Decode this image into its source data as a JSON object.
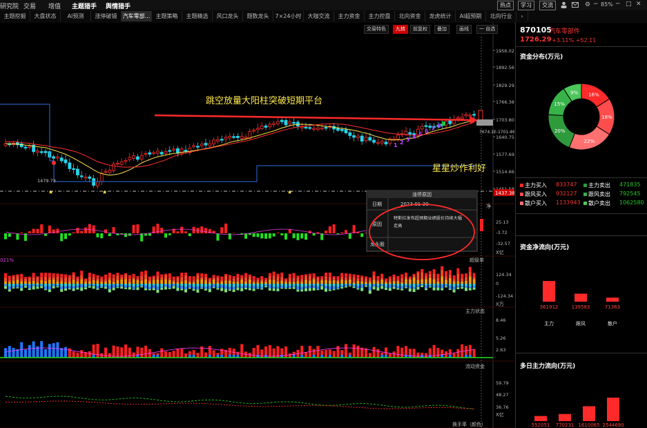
{
  "menu": {
    "items": [
      "研究院",
      "交易",
      "增值",
      "主题猎手",
      "舆情猎手"
    ],
    "right_buttons": [
      "热点",
      "学习",
      "交流"
    ],
    "zoom": "85%"
  },
  "tabs": [
    "主题挖掘",
    "大盘状态",
    "AI预测",
    "涨停破镜",
    "汽车零部...",
    "主题策略",
    "主题精选",
    "风口龙头",
    "题数龙头",
    "7×24小时",
    "大咖交流",
    "主力资金",
    "主力控盘",
    "北向资金",
    "龙虎统计",
    "AI超预期",
    "北向行业"
  ],
  "active_tab": "汽车零部...",
  "toolbar": [
    "交易特色",
    "九转",
    "前复权",
    "叠加",
    "画线",
    "一 自选"
  ],
  "chart": {
    "y_ticks": [
      "1956.02",
      "1892.56",
      "1829.29",
      "1766.38",
      "1703.80",
      "1640.75",
      "1577.69",
      "1514.66",
      "1451.58",
      "1437.38"
    ],
    "current_price_box": "1437.38",
    "low_label": "1479.73",
    "price_label": "7674.1E-1701.46",
    "annotation1": "跳空放量大阳柱突破短期平台",
    "annotation2": "星星炒作利好",
    "magic_digits": [
      "1",
      "2",
      "3",
      "4",
      "5",
      "6",
      "7",
      "8"
    ],
    "panel2": {
      "ticks": [
        "25.13",
        "-3.72",
        "-32.57"
      ],
      "unit": "X亿",
      "label": "净"
    },
    "panel3": {
      "ticks": [
        "124.34",
        "0",
        "-124.34"
      ],
      "unit": "X万",
      "label": "超级单",
      "left_tag": "021%"
    },
    "panel4": {
      "ticks": [
        "8.46",
        "5.26",
        "2.63"
      ],
      "label": "主力状态"
    },
    "panel5": {
      "ticks": [
        "59.79",
        "48.27",
        "36.76"
      ],
      "unit": "X亿",
      "label": "流动资金"
    },
    "bottom_label": "换手率（颜色）"
  },
  "popup": {
    "title": "涨停原因",
    "rows": [
      {
        "key": "日期",
        "value": "2023-01-30"
      },
      {
        "key": "原因",
        "value": "特斯拉发布超预期业绩股价持续大幅走高"
      },
      {
        "key": "龙头股",
        "value": ""
      }
    ]
  },
  "right_panel": {
    "code": "870105",
    "name": "汽车零部件",
    "price": "1726.29",
    "change": "+3.11% +52.11",
    "distribution_title": "资金分布(万元)",
    "donut": [
      {
        "label": "16%",
        "value": 16,
        "color": "#ff2a2a"
      },
      {
        "label": "18%",
        "value": 18,
        "color": "#ff4d4d"
      },
      {
        "label": "22%",
        "value": 22,
        "color": "#ff7070"
      },
      {
        "label": "20%",
        "value": 20,
        "color": "#2e9a3c"
      },
      {
        "label": "15%",
        "value": 15,
        "color": "#37b34a"
      },
      {
        "label": "9%",
        "value": 9,
        "color": "#4cc75a"
      }
    ],
    "flows": [
      {
        "label": "主力买入",
        "value": "833747",
        "color": "#ff2a2a",
        "side": "buy"
      },
      {
        "label": "主力卖出",
        "value": "471835",
        "color": "#2c9a3c",
        "side": "sell"
      },
      {
        "label": "跟风买入",
        "value": "932127",
        "color": "#ff4d4d",
        "side": "buy"
      },
      {
        "label": "跟风卖出",
        "value": "792545",
        "color": "#37b34a",
        "side": "sell"
      },
      {
        "label": "散户买入",
        "value": "1133943",
        "color": "#ff7070",
        "side": "buy"
      },
      {
        "label": "散户卖出",
        "value": "1062580",
        "color": "#4cc75a",
        "side": "sell"
      }
    ],
    "net_title": "资金净流向(万元)",
    "net_bars": [
      {
        "label": "主力",
        "value": 361912,
        "text": "361912"
      },
      {
        "label": "跟风",
        "value": 139583,
        "text": "139583"
      },
      {
        "label": "散户",
        "value": 71363,
        "text": "71363"
      }
    ],
    "multi_title": "多日主力流向(万元)",
    "multi_bars": [
      {
        "value": 552051,
        "text": "552051"
      },
      {
        "value": 770231,
        "text": "770231"
      },
      {
        "value": 1610065,
        "text": "1610065"
      },
      {
        "value": 2544690,
        "text": "2544690"
      }
    ]
  }
}
